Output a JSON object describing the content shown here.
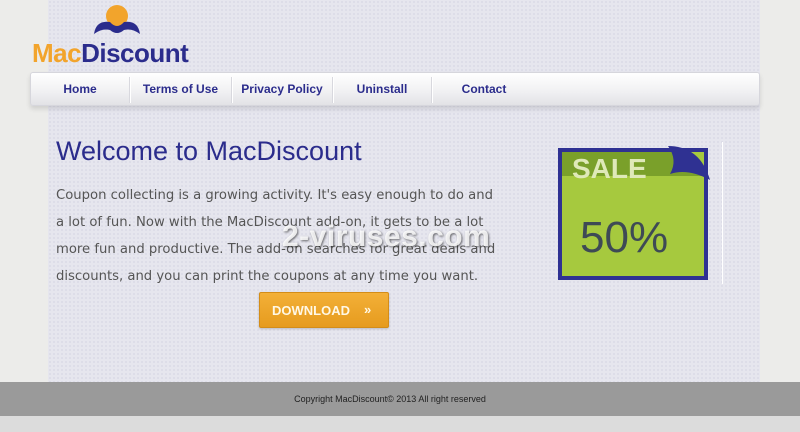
{
  "brand": {
    "logo_mac": "Mac",
    "logo_discount": "Discount"
  },
  "nav": {
    "items": [
      {
        "label": "Home"
      },
      {
        "label": "Terms of Use"
      },
      {
        "label": "Privacy Policy"
      },
      {
        "label": "Uninstall"
      },
      {
        "label": "Contact"
      }
    ]
  },
  "main": {
    "title": "Welcome to MacDiscount",
    "body": "Coupon collecting is a growing activity. It's easy enough to do and a lot of fun. Now with the MacDiscount add-on, it gets to be a lot more fun and productive. The add-on searches for great deals and discounts, and you can print the coupons at any time you want.",
    "download_label": "DOWNLOAD",
    "download_icon": "chevron-double-down-icon"
  },
  "sale_badge": {
    "word": "SALE",
    "percent": "50%"
  },
  "footer": {
    "copyright": "Copyright MacDiscount© 2013 All right reserved"
  },
  "watermark": {
    "text": "2-viruses.com"
  },
  "colors": {
    "brand_navy": "#2b2c8c",
    "brand_orange": "#f2a42c",
    "badge_green": "#a6c93e",
    "button_orange": "#e9a024"
  }
}
